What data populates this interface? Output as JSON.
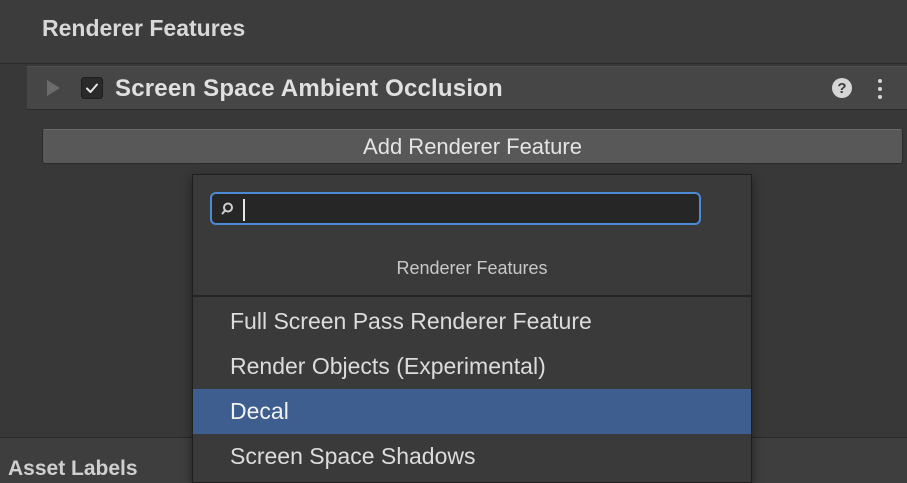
{
  "section": {
    "title": "Renderer Features"
  },
  "feature": {
    "name": "Screen Space Ambient Occlusion",
    "enabled": true,
    "expanded": false,
    "help_glyph": "?",
    "icons": [
      "foldout-arrow",
      "checkbox-check",
      "help-icon",
      "kebab-menu-icon"
    ]
  },
  "add_button": {
    "label": "Add Renderer Feature"
  },
  "dropdown": {
    "search": {
      "value": "",
      "placeholder": ""
    },
    "header": "Renderer Features",
    "items": [
      {
        "label": "Full Screen Pass Renderer Feature",
        "selected": false
      },
      {
        "label": "Render Objects (Experimental)",
        "selected": false
      },
      {
        "label": "Decal",
        "selected": true
      },
      {
        "label": "Screen Space Shadows",
        "selected": false
      }
    ]
  },
  "footer": {
    "label": "Asset Labels"
  },
  "colors": {
    "background": "#383838",
    "selection": "#3d5e8e",
    "focus_outline": "#4c8ad6",
    "button": "#585858"
  }
}
